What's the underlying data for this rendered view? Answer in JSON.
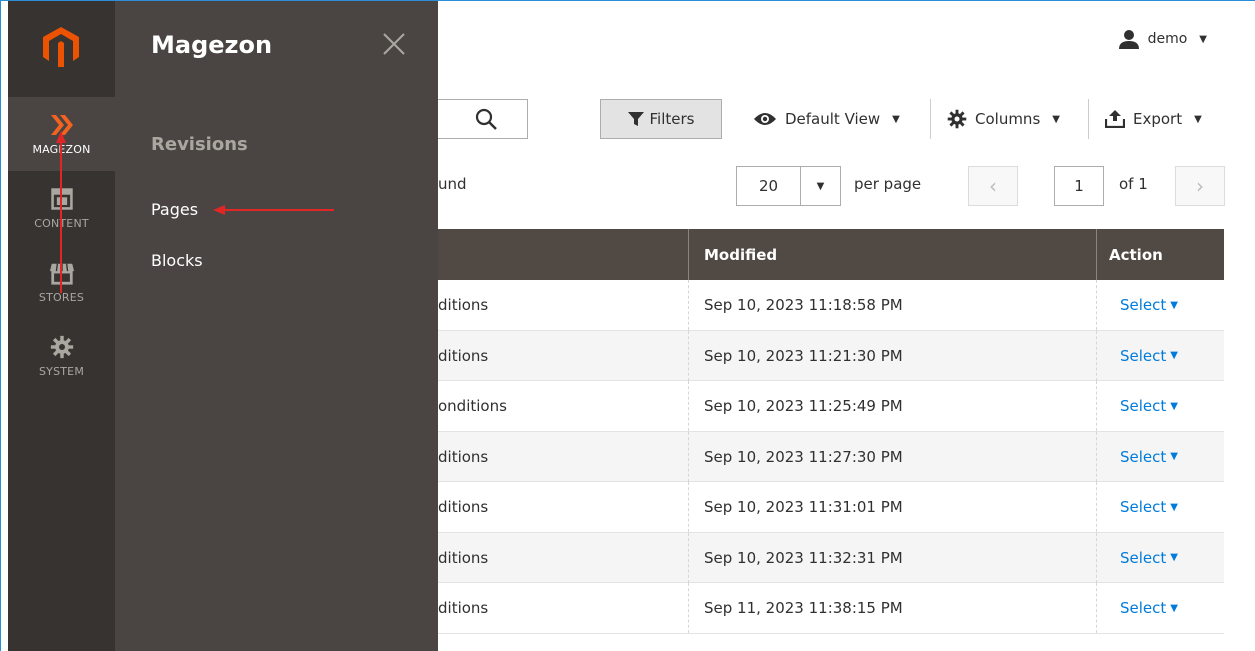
{
  "nav": {
    "items": [
      {
        "label": "MAGEZON",
        "icon": "magezon-icon"
      },
      {
        "label": "CONTENT",
        "icon": "content-icon"
      },
      {
        "label": "STORES",
        "icon": "stores-icon"
      },
      {
        "label": "SYSTEM",
        "icon": "gear-icon"
      }
    ]
  },
  "flyout": {
    "title": "Magezon",
    "section": "Revisions",
    "links": [
      "Pages",
      "Blocks"
    ]
  },
  "user": {
    "name": "demo"
  },
  "toolbar": {
    "filters": "Filters",
    "view": "Default View",
    "columns": "Columns",
    "export": "Export"
  },
  "pager": {
    "found_fragment": "und",
    "per_page_value": "20",
    "per_page_label": "per page",
    "page": "1",
    "of": "of 1"
  },
  "grid": {
    "headers": {
      "modified": "Modified",
      "action": "Action"
    },
    "rows": [
      {
        "title": "ditions",
        "modified": "Sep 10, 2023 11:18:58 PM",
        "action": "Select"
      },
      {
        "title": "ditions",
        "modified": "Sep 10, 2023 11:21:30 PM",
        "action": "Select"
      },
      {
        "title": "onditions",
        "modified": "Sep 10, 2023 11:25:49 PM",
        "action": "Select"
      },
      {
        "title": "ditions",
        "modified": "Sep 10, 2023 11:27:30 PM",
        "action": "Select"
      },
      {
        "title": "ditions",
        "modified": "Sep 10, 2023 11:31:01 PM",
        "action": "Select"
      },
      {
        "title": "ditions",
        "modified": "Sep 10, 2023 11:32:31 PM",
        "action": "Select"
      },
      {
        "title": "ditions",
        "modified": "Sep 11, 2023 11:38:15 PM",
        "action": "Select"
      }
    ]
  },
  "colors": {
    "nav_bg": "#373330",
    "flyout_bg": "#4a4542",
    "header_bg": "#514943",
    "link": "#007bdb",
    "brand_orange": "#eb5202",
    "annotation_red": "#e22626"
  }
}
